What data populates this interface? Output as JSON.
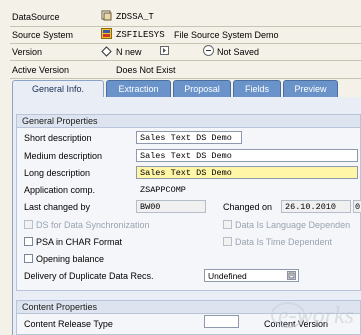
{
  "header": {
    "datasource_label": "DataSource",
    "datasource_value": "ZDSSA_T",
    "source_system_label": "Source System",
    "source_system_value": "ZSFILESYS",
    "source_system_desc": "File Source System Demo",
    "version_label": "Version",
    "version_value": "N new",
    "version_status": "Not Saved",
    "active_version_label": "Active Version",
    "active_version_value": "Does Not Exist"
  },
  "tabs": [
    {
      "label": "General Info."
    },
    {
      "label": "Extraction"
    },
    {
      "label": "Proposal"
    },
    {
      "label": "Fields"
    },
    {
      "label": "Preview"
    }
  ],
  "general": {
    "title": "General Properties",
    "short_desc_label": "Short description",
    "short_desc_value": "Sales Text DS Demo",
    "medium_desc_label": "Medium description",
    "medium_desc_value": "Sales Text DS Demo",
    "long_desc_label": "Long description",
    "long_desc_value": "Sales Text DS Demo",
    "app_comp_label": "Application comp.",
    "app_comp_value": "ZSAPPCOMP",
    "last_changed_label": "Last changed by",
    "last_changed_value": "BW00",
    "changed_on_label": "Changed on",
    "changed_on_value": "26.10.2010",
    "changed_on_extra": "0",
    "ds_data_sync_label": "DS for Data Synchronization",
    "data_lang_dep_label": "Data Is Language Dependen",
    "psa_label": "PSA in CHAR Format",
    "data_time_dep_label": "Data Is Time Dependent",
    "opening_balance_label": "Opening balance",
    "delivery_label": "Delivery of Duplicate Data Recs.",
    "delivery_value": "Undefined"
  },
  "content": {
    "title": "Content Properties",
    "release_type_label": "Content Release Type",
    "content_version_label": "Content Version"
  },
  "watermark": {
    "text": "e-works"
  }
}
